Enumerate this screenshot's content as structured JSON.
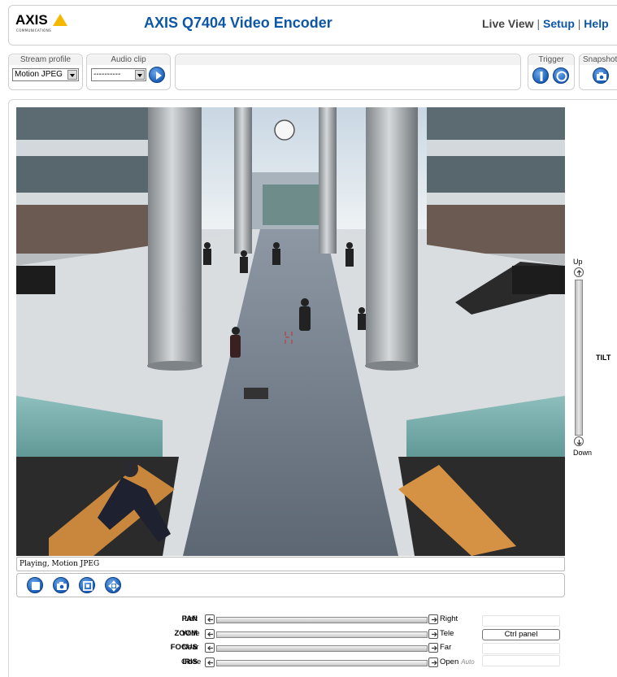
{
  "header": {
    "logo_text": "AXIS",
    "logo_sub": "COMMUNICATIONS",
    "title": "AXIS Q7404 Video Encoder",
    "nav": {
      "live_view": "Live View",
      "sep": "|",
      "setup": "Setup",
      "help": "Help"
    }
  },
  "toolbar": {
    "stream_profile_label": "Stream profile",
    "stream_profile_value": "Motion JPEG",
    "audio_clip_label": "Audio clip",
    "audio_clip_value": "----------",
    "trigger_label": "Trigger",
    "snapshot_label": "Snapshot"
  },
  "video": {
    "status_text": "Playing, Motion JPEG"
  },
  "tilt": {
    "up": "Up",
    "down": "Down",
    "label": "TILT"
  },
  "ptz": [
    {
      "name": "PAN",
      "left": "Left",
      "right": "Right",
      "auto": ""
    },
    {
      "name": "ZOOM",
      "left": "Wide",
      "right": "Tele",
      "auto": ""
    },
    {
      "name": "FOCUS",
      "left": "Near",
      "right": "Far",
      "auto": ""
    },
    {
      "name": "IRIS",
      "left": "Close",
      "right": "Open",
      "auto": "Auto"
    }
  ],
  "ctrl_panel_label": "Ctrl panel",
  "colors": {
    "brand_blue": "#0d57a6",
    "logo_yellow": "#f5b800"
  },
  "icons": [
    "play-icon",
    "trigger-on-icon",
    "trigger-off-icon",
    "snapshot-icon",
    "stop-icon",
    "camera-icon",
    "fullscreen-icon",
    "ptz-icon"
  ]
}
